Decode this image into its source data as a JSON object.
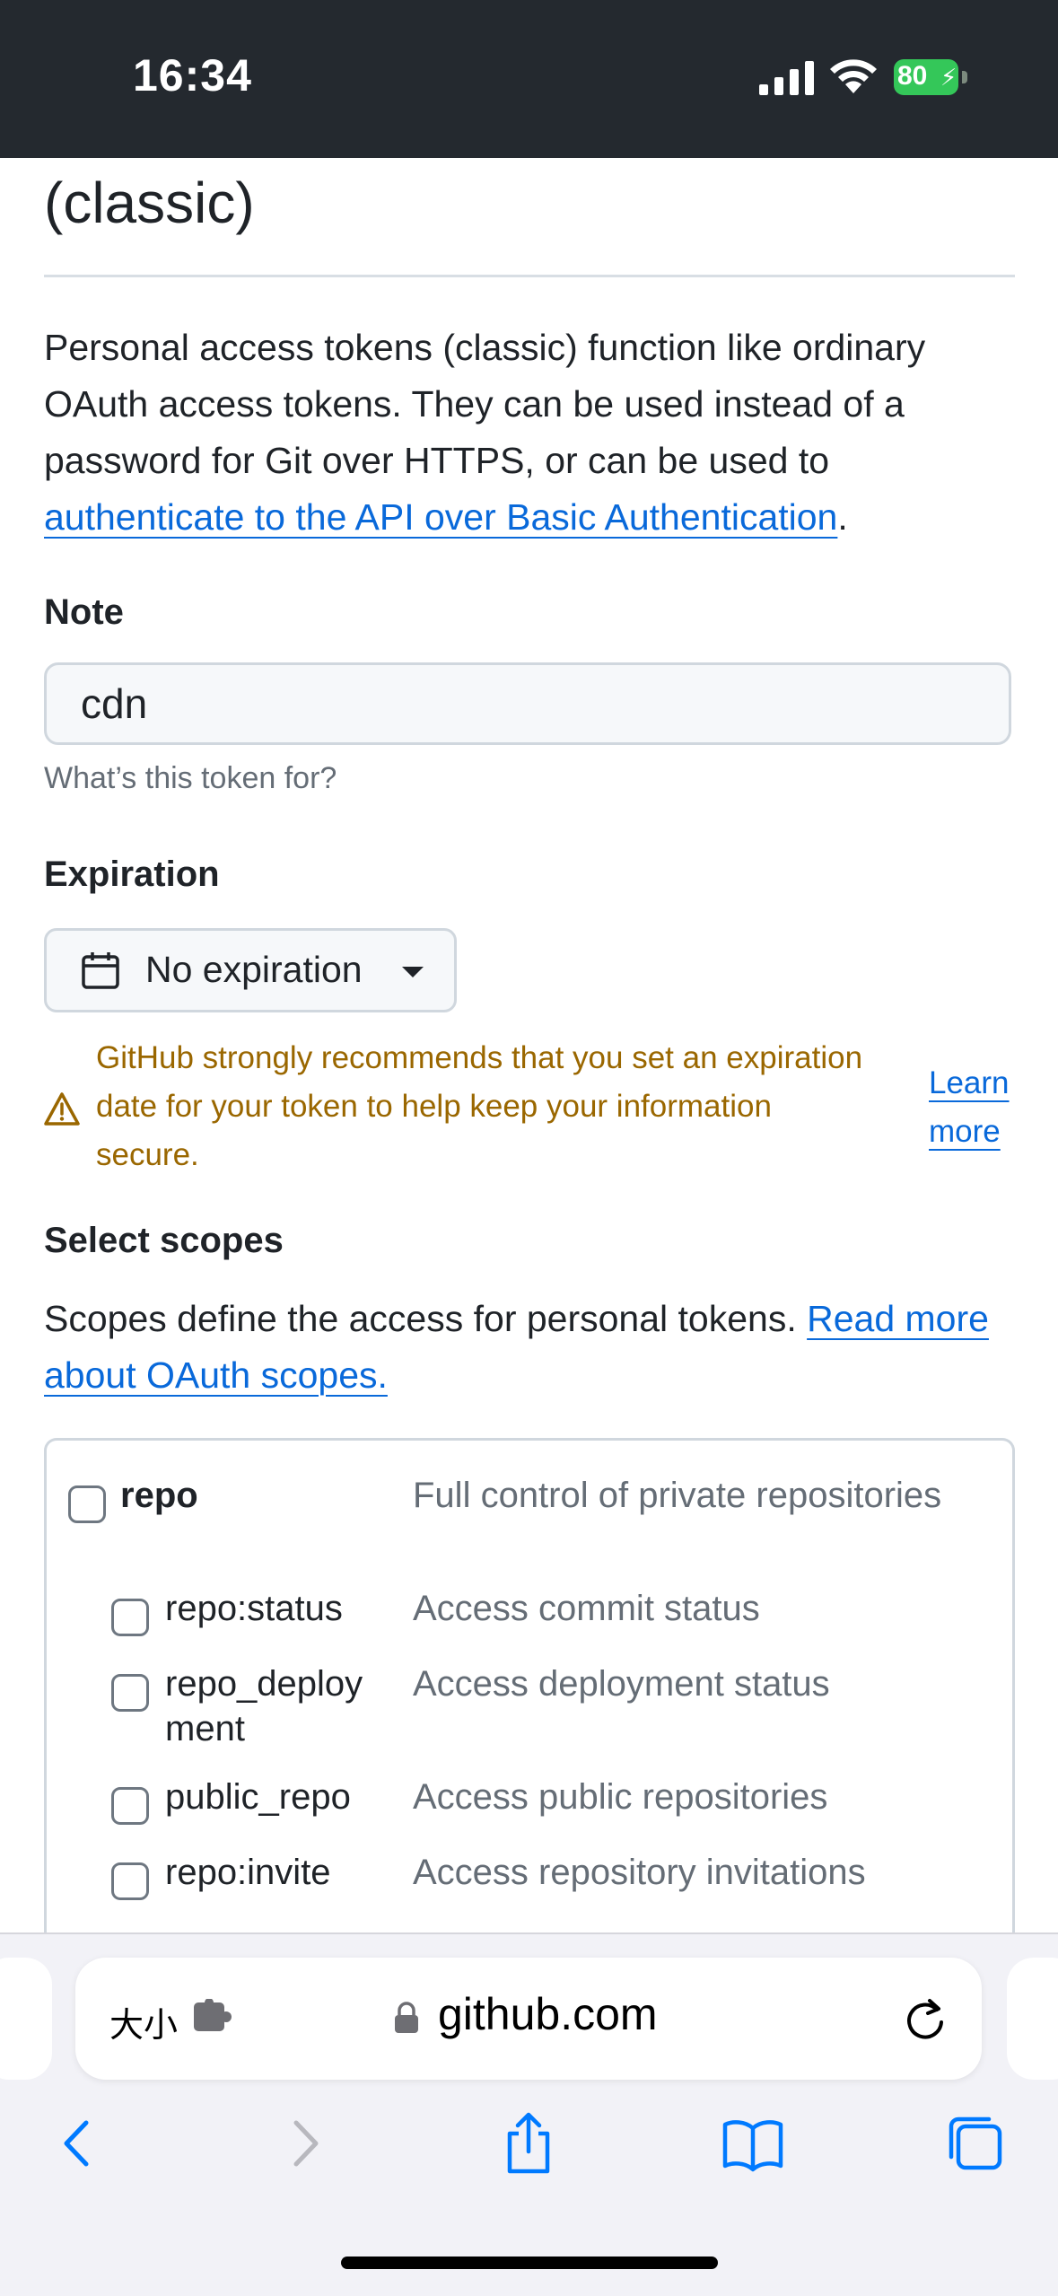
{
  "status_bar": {
    "time": "16:34",
    "battery": "80"
  },
  "page": {
    "title": "(classic)",
    "intro_text": "Personal access tokens (classic) function like ordinary OAuth access tokens. They can be used instead of a password for Git over HTTPS, or can be used to ",
    "intro_link": "authenticate to the API over Basic Authentication",
    "intro_end": "."
  },
  "note": {
    "label": "Note",
    "value": "cdn",
    "hint": "What’s this token for?"
  },
  "expiration": {
    "label": "Expiration",
    "selected": "No expiration",
    "warning": "GitHub strongly recommends that you set an expiration date for your token to help keep your information secure.",
    "learn_more_1": "Learn",
    "learn_more_2": "more"
  },
  "scopes": {
    "label": "Select scopes",
    "description": "Scopes define the access for personal tokens. ",
    "link": "Read more about OAuth scopes.",
    "items": [
      {
        "name": "repo",
        "desc": "Full control of private repositories"
      },
      {
        "name": "repo:status",
        "desc": "Access commit status"
      },
      {
        "name": "repo_deploy ment",
        "desc": "Access deployment status"
      },
      {
        "name": "public_repo",
        "desc": "Access public repositories"
      },
      {
        "name": "repo:invite",
        "desc": "Access repository invitations"
      }
    ]
  },
  "browser": {
    "text_size": "大小",
    "domain": "github.com"
  },
  "colors": {
    "link": "#0969da",
    "warning": "#9a6700",
    "status_bar_bg": "#24292f",
    "battery": "#34c759"
  }
}
